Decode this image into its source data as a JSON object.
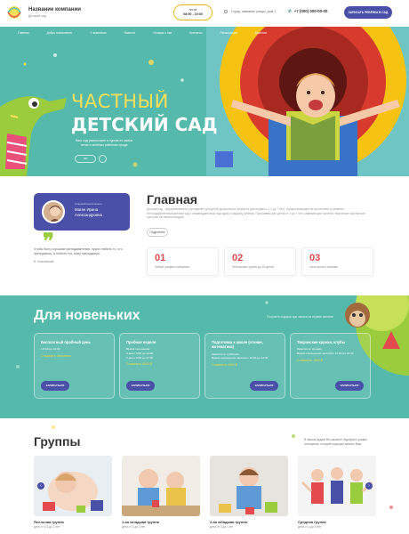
{
  "header": {
    "company_name": "Название компании",
    "company_sub": "Детский сад",
    "hours_line1": "пн-пт",
    "hours_line2": "08:00 - 19:00",
    "address": "Город, название улицы, дом 1",
    "phone": "+7 (000) 000-00-00",
    "signup_label": "Записать ребёнка в сад"
  },
  "nav": {
    "items": [
      "Главная",
      "Добро пожаловать",
      "О компании",
      "Новости",
      "Отзывы о нас",
      "Контакты",
      "Регистрация",
      "Дисплеи"
    ]
  },
  "hero": {
    "title1": "ЧАСТНЫЙ",
    "title2": "ДЕТСКИЙ САД",
    "subtitle": "Наш сад расположен в одном из самых тихих и зелёных районов города",
    "ctrl_label": "◂ ▸"
  },
  "main": {
    "caretaker_role": "Старший воспитатель",
    "caretaker_name": "Маган Ирина Александровна",
    "quote_mark": "❞",
    "quote_text": "Чтобы быть хорошим преподавателем, нужно любить то, что преподаешь, и любить тех, кому преподаешь.",
    "quote_author": "В. Ключевский",
    "title": "Главная",
    "text": "Детский сад - образовательное учреждение для детей дошкольного возраста (как правило, с 2 до 7 лет), осуществляющее их воспитание и развитие. Негосударственный детский сад с индивидуальным подходом к каждому ребёнку. Программы для детей от 2 до 7 лет, развивающие занятия, творческие мастерские, прогулки на свежем воздухе.",
    "more_label": "Подробнее",
    "stats": [
      {
        "num": "01",
        "label": "Гибкий график посещения"
      },
      {
        "num": "02",
        "label": "Небольшие группы до 15 детей"
      },
      {
        "num": "03",
        "label": "Своя кухня и питание"
      }
    ]
  },
  "newcomers": {
    "title": "Для новеньких",
    "link": "Получите подарок при записи на первое занятие",
    "offers": [
      {
        "title": "Бесплатный пробный день",
        "lines": [
          "с 8:00 до 12:00"
        ],
        "price": "Стоимость: бесплатно",
        "btn": "Записаться",
        "btn_align": "left"
      },
      {
        "title": "Пробная неделя",
        "lines": [
          "Время посещения:",
          "3 дня с 8:00 до 12:00",
          "2 дня с 8:00 до 17:00"
        ],
        "price": "Стоимость: 6000 ₽",
        "btn": "Записаться",
        "btn_align": "left"
      },
      {
        "title": "Подготовка к школе (чтение, математика)",
        "lines": [
          "Занятия по субботам",
          "Время проведения занятия с 10:00 до 13:00"
        ],
        "price": "Стоимость: 2000 ₽",
        "btn": "Записаться",
        "btn_align": "right"
      },
      {
        "title": "Творческие кружки, клубы",
        "lines": [
          "Занятия по средам",
          "Время проведения занятий с 17:00 до 18:00"
        ],
        "price": "Стоимость: 1500 ₽",
        "btn": "Записаться",
        "btn_align": "right"
      }
    ]
  },
  "groups": {
    "title": "Группы",
    "description": "В нашем садике Вы сможете подобрать график посещения, который подходит именно Вам",
    "items": [
      {
        "name": "Ясельная группа",
        "age": "дети от 1,5 до 2 лет"
      },
      {
        "name": "1-ая младшая группа",
        "age": "дети от 2 до 3 лет"
      },
      {
        "name": "2-ая младшая группа",
        "age": "дети от 3 до 4 лет"
      },
      {
        "name": "Средняя группа",
        "age": "дети от 4 до 5 лет"
      }
    ]
  },
  "colors": {
    "teal": "#55b9ab",
    "accent_blue": "#4a4fa8",
    "yellow": "#fae05a",
    "red": "#e4494e",
    "green": "#9bcc3e"
  }
}
